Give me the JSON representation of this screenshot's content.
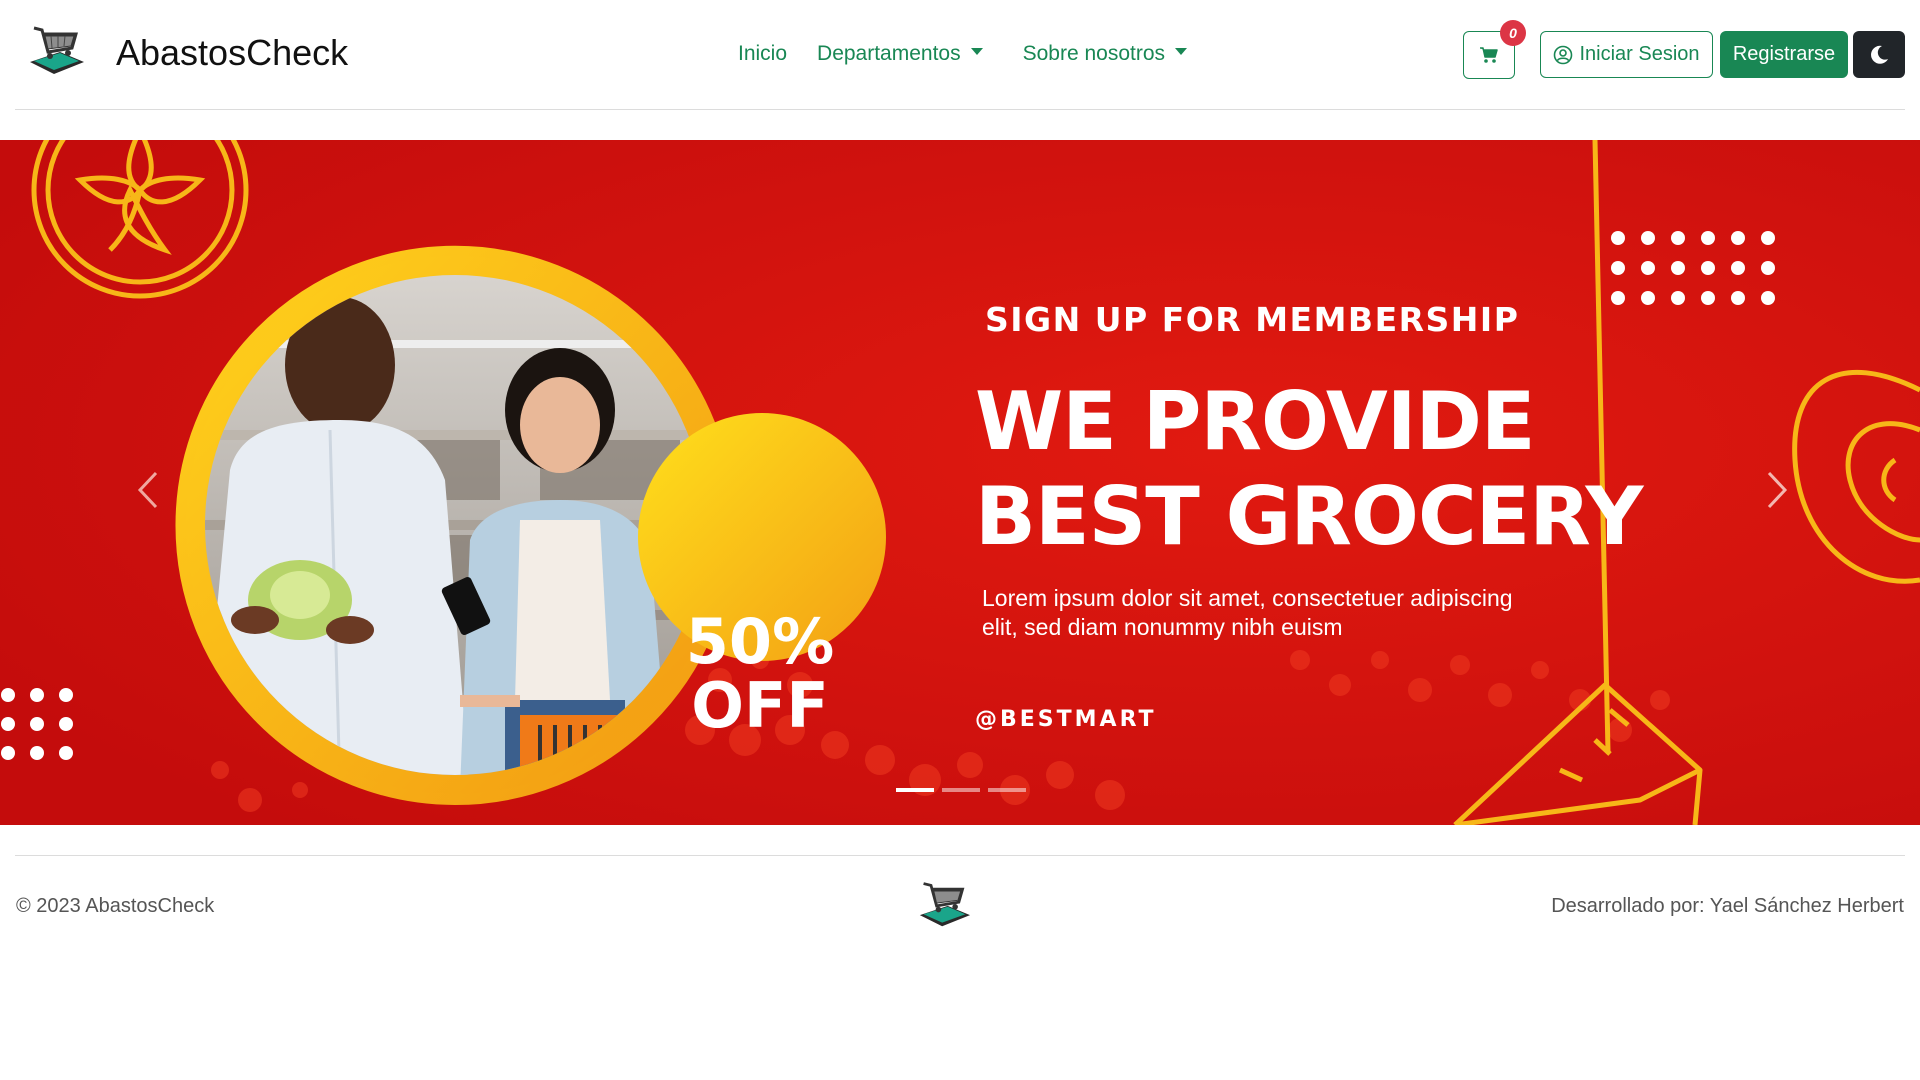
{
  "header": {
    "brand_name": "AbastosCheck",
    "logo_icon": "shopping-cart-logo-icon",
    "nav": [
      {
        "label": "Inicio",
        "dropdown": false
      },
      {
        "label": "Departamentos",
        "dropdown": true
      },
      {
        "label": "Sobre nosotros",
        "dropdown": true
      }
    ],
    "cart_count": "0",
    "login_label": "Iniciar Sesion",
    "register_label": "Registrarse",
    "colors": {
      "accent": "#198754",
      "badge": "#dc3545",
      "dark": "#212529"
    }
  },
  "carousel": {
    "slide_count": 3,
    "active_index": 0,
    "banner": {
      "signup": "SIGN UP FOR MEMBERSHIP",
      "headline_line1": "WE PROVIDE",
      "headline_line2": "BEST GROCERY",
      "lorem_line1": "Lorem ipsum dolor sit amet, consectetuer adipiscing",
      "lorem_line2": "elit, sed diam nonummy nibh euism",
      "handle": "@BESTMART",
      "discount_pct": "50%",
      "discount_off": "OFF",
      "colors": {
        "background": "#d9140f",
        "accent": "#f7b718"
      }
    }
  },
  "footer": {
    "copyright": "© 2023 AbastosCheck",
    "credit": "Desarrollado por: Yael Sánchez Herbert"
  }
}
